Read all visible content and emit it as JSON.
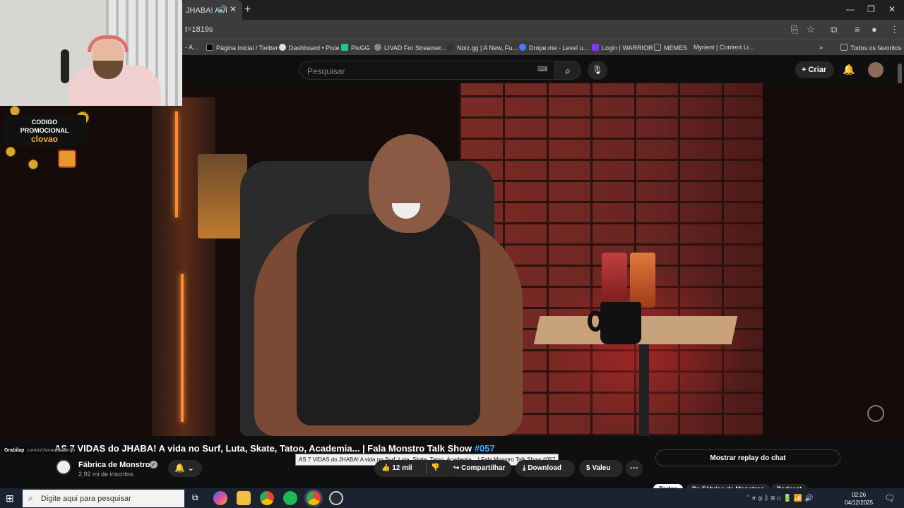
{
  "browser": {
    "tab_title": "JHABA! A vi",
    "url": "t=1819s",
    "window_controls": [
      "—",
      "❐",
      "✕"
    ]
  },
  "bookmarks": {
    "items": [
      {
        "label": "- A...",
        "color": "#555555"
      },
      {
        "label": "Página Inicial / Twitter",
        "color": "#000000"
      },
      {
        "label": "Dashboard • Pixie",
        "color": "#e0e0e0"
      },
      {
        "label": "PixGG",
        "color": "#22c3a0"
      },
      {
        "label": "LIVAD For Streamer...",
        "color": "#888888"
      },
      {
        "label": "Noiz.gg | A New, Fu...",
        "color": "#333333"
      },
      {
        "label": "Drope.me - Level u...",
        "color": "#4a7aff"
      },
      {
        "label": "Login | WARRIOR",
        "color": "#7a3aff"
      },
      {
        "label": "MEMES",
        "color": "#aaaaaa"
      },
      {
        "label": "Myrient | Content Li...",
        "color": "#555555"
      }
    ],
    "all_favorites": "Todos os favoritos"
  },
  "youtube": {
    "search_placeholder": "Pesquisar",
    "create_label": "Criar"
  },
  "overlay": {
    "promo_line1": "CODIGO",
    "promo_line2": "PROMOCIONAL",
    "promo_code": "clovao",
    "grab_label": "Grabilap",
    "grab_link": ".com/c/clovaodbaerdja"
  },
  "video": {
    "title_main": "AS 7 VIDAS do JHABA! A vida no Surf, Luta, Skate, Tatoo, Academia... | Fala Monstro Talk Show",
    "title_tag": "#057",
    "tooltip": "AS 7 VIDAS do JHABA! A vida no Surf, Luta, Skate, Tatoo, Academia... | Fala Monstro Talk Show #057",
    "channel_name": "Fábrica de Monstros",
    "subscribers": "2,92 mi de inscritos",
    "likes": "12 mil",
    "share_label": "Compartilhar",
    "download_label": "Download",
    "thanks_label": "Valeu",
    "chat_replay": "Mostrar replay do chat",
    "chips": [
      "Todos",
      "De Fábrica de Monstros",
      "Podcast"
    ]
  },
  "taskbar": {
    "search_placeholder": "Digite aqui para pesquisar",
    "time": "02:26",
    "date": "04/12/2025"
  }
}
